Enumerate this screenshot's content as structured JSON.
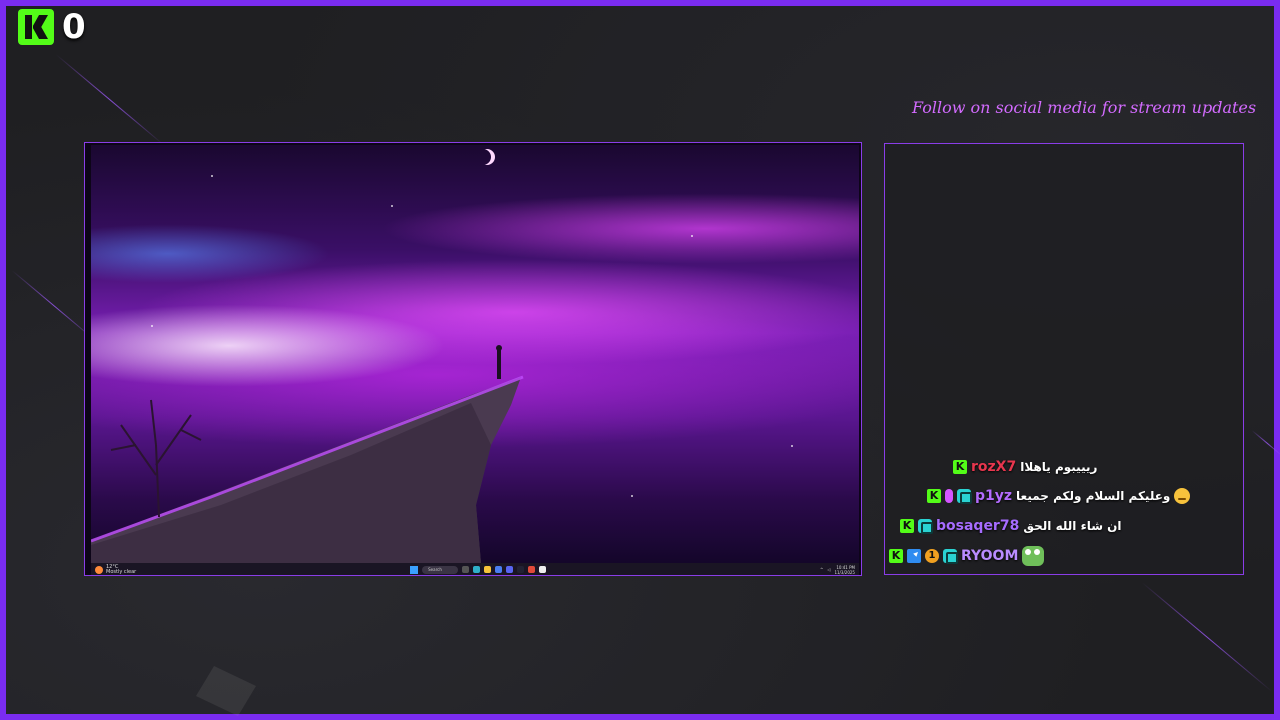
{
  "viewer_badge": {
    "count": "0",
    "icon": "kick-logo-icon"
  },
  "social": {
    "text": "Follow on social media for stream updates"
  },
  "screen": {
    "taskbar": {
      "weather_temp": "12°C",
      "weather_desc": "Mostly clear",
      "search_placeholder": "Search",
      "time": "10:41 PM",
      "date": "11/3/2025"
    }
  },
  "chat": {
    "messages": [
      {
        "username": "rozX7",
        "text": "ريييبوم ياهلاا",
        "color": "#e8364e",
        "badges": [
          "kick-icon"
        ]
      },
      {
        "username": "p1yz",
        "text": "وعليكم السلام ولكم جميعا",
        "color": "#b46cff",
        "badges": [
          "kick-icon",
          "mic-icon",
          "og-icon"
        ],
        "emote": "sad-face-emote"
      },
      {
        "username": "bosaqer78",
        "text": "ان شاء الله الحق",
        "color": "#a66cff",
        "badges": [
          "kick-icon",
          "og-icon"
        ]
      },
      {
        "username": "RYOOM",
        "text": "",
        "color": "#b98cff",
        "badges": [
          "kick-icon",
          "mod-icon",
          "gift-icon",
          "og-icon"
        ],
        "emote": "frog-emote"
      }
    ]
  },
  "colors": {
    "frame": "#7a2cf0",
    "kick_green": "#53fc18",
    "social_text": "#d36bff"
  }
}
